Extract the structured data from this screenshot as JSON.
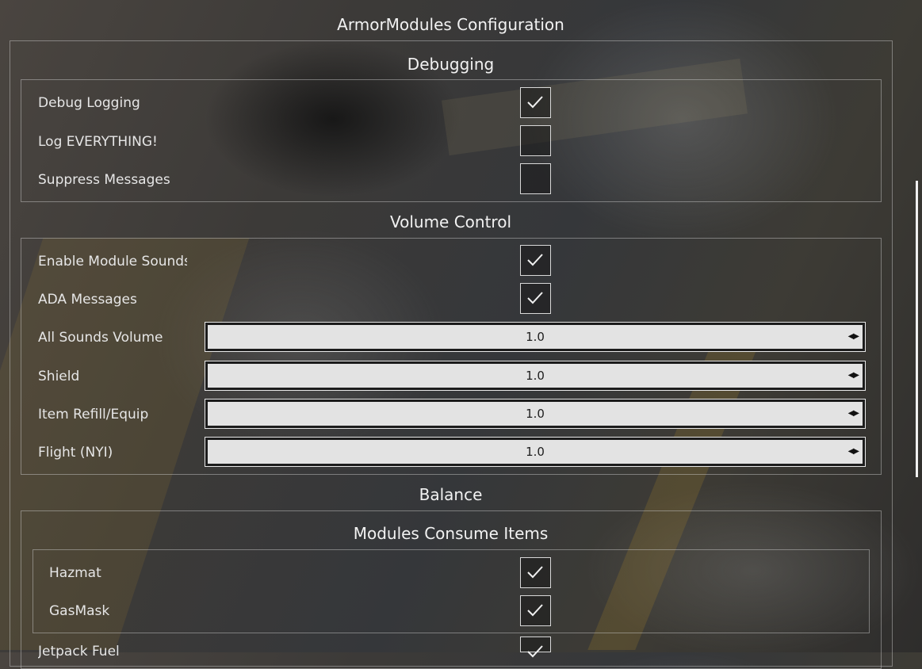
{
  "window": {
    "title": "ArmorModules Configuration"
  },
  "sections": {
    "debugging": {
      "title": "Debugging",
      "rows": [
        {
          "label": "Debug Logging",
          "checked": true
        },
        {
          "label": "Log EVERYTHING!",
          "checked": false
        },
        {
          "label": "Suppress Messages",
          "checked": false
        }
      ]
    },
    "volume": {
      "title": "Volume Control",
      "rows": [
        {
          "label": "Enable Module Sounds",
          "checked": true
        },
        {
          "label": "ADA Messages",
          "checked": true
        }
      ],
      "sliders": [
        {
          "label": "All Sounds Volume",
          "value": "1.0"
        },
        {
          "label": "Shield",
          "value": "1.0"
        },
        {
          "label": "Item Refill/Equip",
          "value": "1.0"
        },
        {
          "label": "Flight (NYI)",
          "value": "1.0"
        }
      ]
    },
    "balance": {
      "title": "Balance",
      "subsection": {
        "title": "Modules Consume Items",
        "rows": [
          {
            "label": "Hazmat",
            "checked": true
          },
          {
            "label": "GasMask",
            "checked": true
          },
          {
            "label": "Jetpack Fuel",
            "checked": true
          }
        ]
      }
    }
  },
  "icons": {
    "check": "check-icon",
    "arrows": "left-right-arrows-icon"
  },
  "colors": {
    "accent": "#e3e3e3",
    "border": "#d8d8d8"
  }
}
